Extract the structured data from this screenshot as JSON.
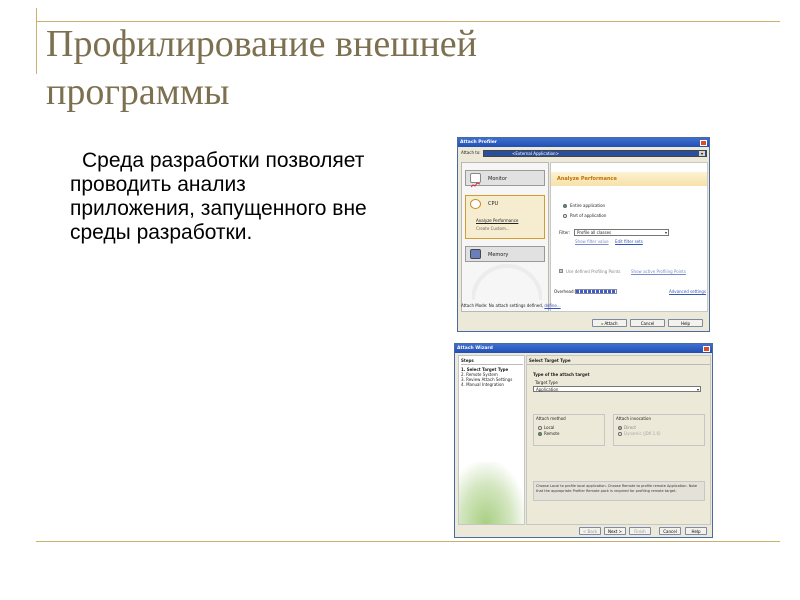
{
  "slide": {
    "title": "Профилирование внешней программы",
    "body": "Среда разработки позволяет проводить анализ приложения, запущенного вне среды разработки."
  },
  "colors": {
    "title": "#7c7050",
    "rule": "#c9b070",
    "window_title": "#1f4fb2",
    "accent_orange": "#c07000"
  },
  "attach_profiler": {
    "title": "Attach Profiler",
    "attach_to_label": "Attach to:",
    "attach_to_value": "<External Application>",
    "modes": [
      {
        "label": "Monitor",
        "icon": "monitor-icon"
      },
      {
        "label": "CPU",
        "icon": "cpu-icon",
        "sub_items": [
          "Analyze Performance",
          "Create Custom..."
        ]
      },
      {
        "label": "Memory",
        "icon": "memory-icon"
      }
    ],
    "panel_title": "Analyze Performance",
    "entire_application": "Entire application",
    "part_of_application": "Part of application",
    "filter_label": "Filter:",
    "filter_value": "Profile all classes",
    "show_filter_value": "Show filter value",
    "edit_filter_sets": "Edit filter sets",
    "use_profiling_points": "Use defined Profiling Points",
    "show_active_points": "Show active Profiling Points",
    "overhead_label": "Overhead:",
    "advanced_settings": "Advanced settings",
    "attach_mode_text": "Attach Mode:  No attach settings defined,",
    "attach_mode_link": "define...",
    "buttons": {
      "attach": "Attach",
      "cancel": "Cancel",
      "help": "Help"
    }
  },
  "attach_wizard": {
    "title": "Attach Wizard",
    "steps_heading": "Steps",
    "steps": [
      "1.  Select Target Type",
      "2.  Remote System",
      "3.  Review Attach Settings",
      "4.  Manual Integration"
    ],
    "page_title": "Select Target Type",
    "type_section": "Type of the attach target",
    "target_type_label": "Target Type",
    "target_type_value": "Application",
    "attach_method_label": "Attach method",
    "method_local": "Local",
    "method_remote": "Remote",
    "attach_invocation_label": "Attach invocation",
    "invocation_direct": "Direct",
    "invocation_dynamic": "Dynamic (JDK 1.6)",
    "info_text": "Choose Local to profile local application. Choose Remote to profile remote Application. Note that the appropriate Profiler Remote pack is required for profiling remote target.",
    "buttons": {
      "back": "< Back",
      "next": "Next >",
      "finish": "Finish",
      "cancel": "Cancel",
      "help": "Help"
    }
  }
}
